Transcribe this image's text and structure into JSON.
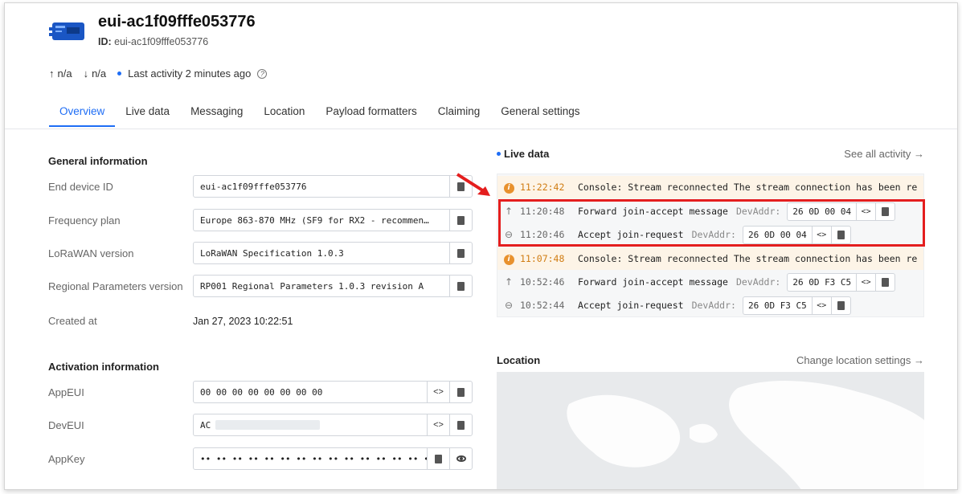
{
  "device": {
    "title": "eui-ac1f09fffe053776",
    "id_label": "ID:",
    "id_value": "eui-ac1f09fffe053776"
  },
  "stats": {
    "uplink": "n/a",
    "downlink": "n/a",
    "last_activity": "Last activity 2 minutes ago"
  },
  "tabs": [
    "Overview",
    "Live data",
    "Messaging",
    "Location",
    "Payload formatters",
    "Claiming",
    "General settings"
  ],
  "general": {
    "title": "General information",
    "end_device_id_label": "End device ID",
    "end_device_id": "eui-ac1f09fffe053776",
    "frequency_plan_label": "Frequency plan",
    "frequency_plan": "Europe 863-870 MHz (SF9 for RX2 - recommen…",
    "lorawan_version_label": "LoRaWAN version",
    "lorawan_version": "LoRaWAN Specification 1.0.3",
    "regional_params_label": "Regional Parameters version",
    "regional_params": "RP001 Regional Parameters 1.0.3 revision A",
    "created_label": "Created at",
    "created": "Jan 27, 2023 10:22:51"
  },
  "activation": {
    "title": "Activation information",
    "appeui_label": "AppEUI",
    "appeui": "00 00 00 00 00 00 00 00",
    "deveui_label": "DevEUI",
    "deveui": "AC",
    "appkey_label": "AppKey",
    "appkey": "•• •• •• •• •• •• •• •• •• •• •• •• •• •• •• ••"
  },
  "live": {
    "title": "Live data",
    "see_all": "See all activity →",
    "events": [
      {
        "time": "11:22:42",
        "kind": "warn",
        "msg": "Console: Stream reconnected  The stream connection has been re"
      },
      {
        "time": "11:20:48",
        "kind": "up",
        "msg": "Forward join-accept message",
        "devaddr_label": "DevAddr:",
        "devaddr": "26 0D 00 04"
      },
      {
        "time": "11:20:46",
        "kind": "link",
        "msg": "Accept join-request",
        "devaddr_label": "DevAddr:",
        "devaddr": "26 0D 00 04"
      },
      {
        "time": "11:07:48",
        "kind": "warn",
        "msg": "Console: Stream reconnected  The stream connection has been re"
      },
      {
        "time": "10:52:46",
        "kind": "up",
        "msg": "Forward join-accept message",
        "devaddr_label": "DevAddr:",
        "devaddr": "26 0D F3 C5"
      },
      {
        "time": "10:52:44",
        "kind": "link",
        "msg": "Accept join-request",
        "devaddr_label": "DevAddr:",
        "devaddr": "26 0D F3 C5"
      }
    ]
  },
  "location": {
    "title": "Location",
    "change": "Change location settings →"
  },
  "colors": {
    "accent": "#1e6df5",
    "warning": "#e8912d",
    "highlight": "#e41e1e"
  }
}
